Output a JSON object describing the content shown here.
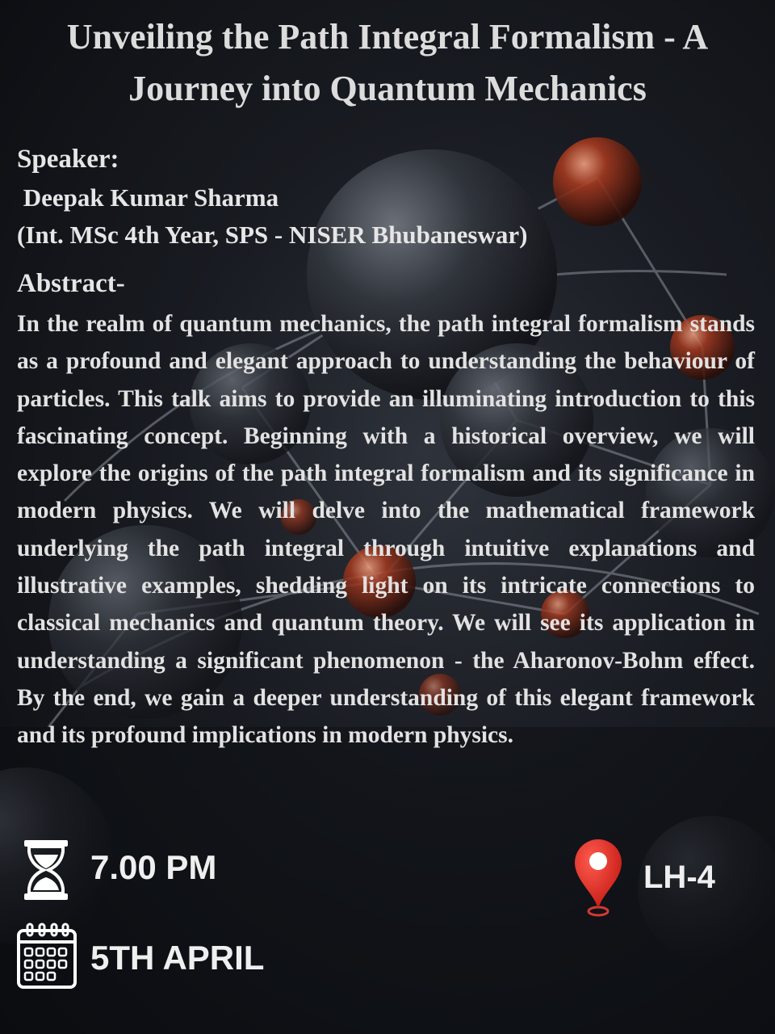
{
  "title": "Unveiling the Path Integral Formalism - A Journey into Quantum Mechanics",
  "speaker": {
    "heading": "Speaker:",
    "name": " Deepak Kumar Sharma",
    "affiliation": "(Int. MSc 4th Year, SPS - NISER Bhubaneswar)"
  },
  "abstract": {
    "heading": "Abstract-",
    "text": "In the realm of quantum mechanics, the path integral formalism stands as a profound and elegant approach to understanding the behaviour of particles. This talk aims to provide an illuminating introduction to this fascinating concept. Beginning with a historical overview, we will explore the origins of the path integral formalism and its significance in modern physics. We will delve into the mathematical framework underlying the path integral through intuitive explanations and illustrative examples, shedding light on its intricate connections to classical mechanics and quantum theory. We will see its application in understanding a significant phenomenon - the Aharonov-Bohm effect. By the end, we gain a deeper understanding of this elegant framework and its profound implications in modern physics."
  },
  "event": {
    "time": "7.00 PM",
    "date": "5TH APRIL",
    "venue": "LH-4"
  },
  "icons": {
    "time": "hourglass-icon",
    "date": "calendar-icon",
    "venue": "location-pin-icon"
  },
  "colors": {
    "background": "#0e1015",
    "text": "#e6e6e6",
    "pin": "#e0261f"
  }
}
